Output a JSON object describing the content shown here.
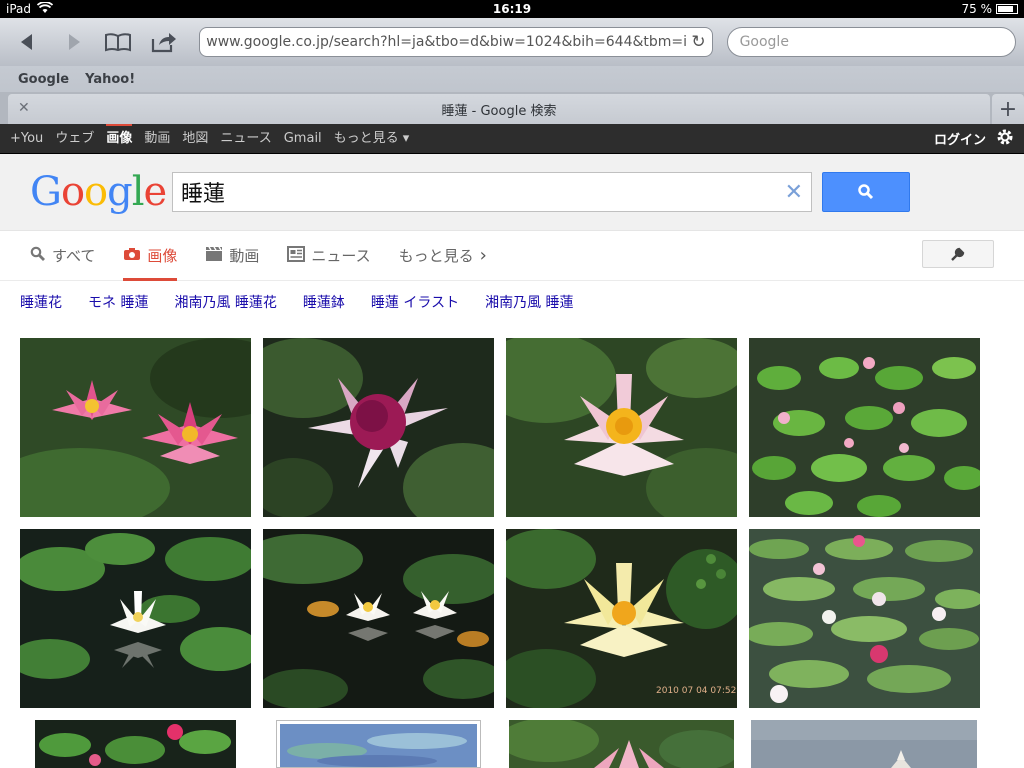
{
  "status_bar": {
    "device": "iPad",
    "time": "16:19",
    "battery": "75 %",
    "battery_level": 0.75
  },
  "browser": {
    "url": "www.google.co.jp/search?hl=ja&tbo=d&biw=1024&bih=644&tbm=isch&sa",
    "search_placeholder": "Google",
    "bookmarks": [
      "Google",
      "Yahoo!"
    ],
    "tab_title": "睡蓮 - Google 検索"
  },
  "gbar": {
    "links": [
      "+You",
      "ウェブ",
      "画像",
      "動画",
      "地図",
      "ニュース",
      "Gmail",
      "もっと見る ▾"
    ],
    "login": "ログイン"
  },
  "search": {
    "logo_letters": [
      "G",
      "o",
      "o",
      "g",
      "l",
      "e"
    ],
    "query": "睡蓮"
  },
  "modes": [
    {
      "label": "すべて",
      "icon": "search-icon"
    },
    {
      "label": "画像",
      "icon": "camera-icon",
      "active": true
    },
    {
      "label": "動画",
      "icon": "film-icon"
    },
    {
      "label": "ニュース",
      "icon": "news-icon"
    },
    {
      "label": "もっと見る",
      "icon": "chevron-right-icon"
    }
  ],
  "related": [
    "睡蓮花",
    "モネ 睡蓮",
    "湘南乃風 睡蓮花",
    "睡蓮鉢",
    "睡蓮 イラスト",
    "湘南乃風 睡蓮"
  ]
}
